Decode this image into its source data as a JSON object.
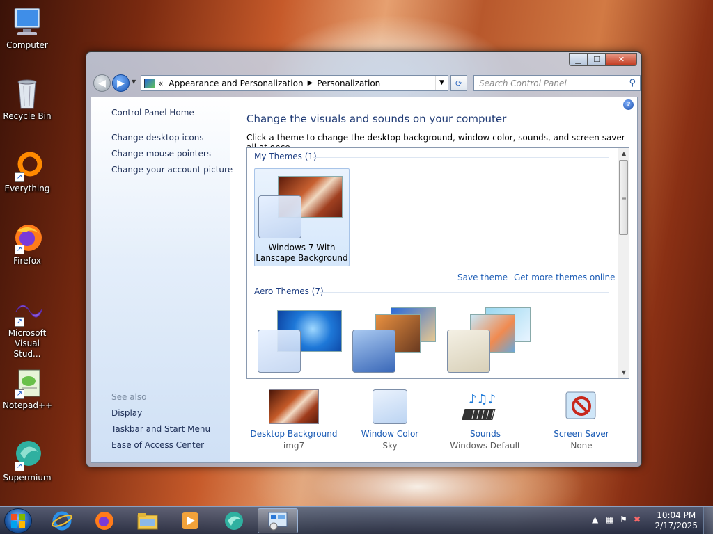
{
  "desktop": {
    "icons": [
      {
        "label": "Computer",
        "icon": "computer-icon"
      },
      {
        "label": "Recycle Bin",
        "icon": "recycle-bin-icon"
      },
      {
        "label": "Everything",
        "icon": "everything-icon"
      },
      {
        "label": "Firefox",
        "icon": "firefox-icon"
      },
      {
        "label": "Microsoft Visual Stud...",
        "icon": "visual-studio-icon"
      },
      {
        "label": "Notepad++",
        "icon": "notepadpp-icon"
      },
      {
        "label": "Supermium",
        "icon": "supermium-icon"
      }
    ]
  },
  "window": {
    "address": {
      "prefix": "«",
      "crumbs": [
        "Appearance and Personalization",
        "Personalization"
      ]
    },
    "search_placeholder": "Search Control Panel",
    "left_pane": {
      "home": "Control Panel Home",
      "links": [
        "Change desktop icons",
        "Change mouse pointers",
        "Change your account picture"
      ],
      "see_also_label": "See also",
      "see_also": [
        "Display",
        "Taskbar and Start Menu",
        "Ease of Access Center"
      ]
    },
    "main": {
      "title": "Change the visuals and sounds on your computer",
      "description": "Click a theme to change the desktop background, window color, sounds, and screen saver all at once.",
      "my_themes_header": "My Themes (1)",
      "my_theme_name": "Windows 7 With Lanscape Background",
      "save_theme": "Save theme",
      "get_more": "Get more themes online",
      "aero_header": "Aero Themes (7)"
    },
    "bottom": {
      "desktop_background": {
        "label": "Desktop Background",
        "value": "img7"
      },
      "window_color": {
        "label": "Window Color",
        "value": "Sky"
      },
      "sounds": {
        "label": "Sounds",
        "value": "Windows Default"
      },
      "screen_saver": {
        "label": "Screen Saver",
        "value": "None"
      }
    }
  },
  "taskbar": {
    "apps": [
      "internet-explorer-icon",
      "firefox-icon",
      "file-explorer-icon",
      "media-player-icon",
      "supermium-icon",
      "personalization-icon"
    ],
    "clock": {
      "time": "10:04 PM",
      "date": "2/17/2025"
    }
  },
  "colors": {
    "link": "#1a5bb5",
    "title": "#1f3a74"
  }
}
